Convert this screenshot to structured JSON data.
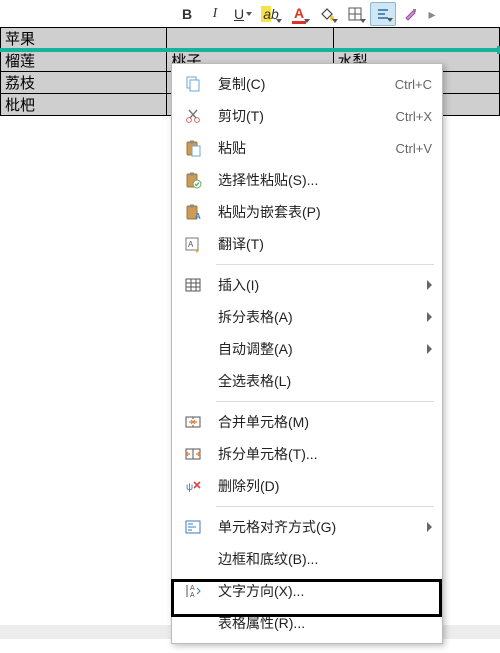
{
  "table": {
    "rows": [
      [
        "苹果",
        "",
        ""
      ],
      [
        "榴莲",
        "桃子",
        "水梨"
      ],
      [
        "荔枝",
        "",
        ""
      ],
      [
        "枇杷",
        "",
        ""
      ]
    ],
    "selected_row_index": 1
  },
  "toolbar": {
    "bold_glyph": "B",
    "italic_glyph": "I",
    "underline_glyph": "U",
    "highlight_glyph": "ab",
    "fontcolor_glyph": "A"
  },
  "colors": {
    "selection": "#17b29c",
    "cell_bg": "#cfcfcf"
  },
  "context_menu": {
    "items": [
      {
        "icon": "copy-icon",
        "label": "复制(C)",
        "shortcut": "Ctrl+C"
      },
      {
        "icon": "cut-icon",
        "label": "剪切(T)",
        "shortcut": "Ctrl+X"
      },
      {
        "icon": "paste-icon",
        "label": "粘贴",
        "shortcut": "Ctrl+V"
      },
      {
        "icon": "paste-special-icon",
        "label": "选择性粘贴(S)...",
        "shortcut": ""
      },
      {
        "icon": "paste-nested-icon",
        "label": "粘贴为嵌套表(P)",
        "shortcut": ""
      },
      {
        "icon": "translate-icon",
        "label": "翻译(T)",
        "shortcut": ""
      },
      {
        "sep": true
      },
      {
        "icon": "table-icon",
        "label": "插入(I)",
        "submenu": true
      },
      {
        "icon": "",
        "label": "拆分表格(A)",
        "submenu": true
      },
      {
        "icon": "",
        "label": "自动调整(A)",
        "submenu": true
      },
      {
        "icon": "",
        "label": "全选表格(L)",
        "shortcut": ""
      },
      {
        "sep": true
      },
      {
        "icon": "merge-cells-icon",
        "label": "合并单元格(M)",
        "shortcut": ""
      },
      {
        "icon": "split-cells-icon",
        "label": "拆分单元格(T)...",
        "shortcut": ""
      },
      {
        "icon": "delete-col-icon",
        "label": "删除列(D)",
        "shortcut": ""
      },
      {
        "sep": true
      },
      {
        "icon": "cell-align-icon",
        "label": "单元格对齐方式(G)",
        "submenu": true,
        "highlighted": true
      },
      {
        "icon": "",
        "label": "边框和底纹(B)...",
        "shortcut": ""
      },
      {
        "icon": "text-dir-icon",
        "label": "文字方向(X)...",
        "shortcut": ""
      },
      {
        "icon": "",
        "label": "表格属性(R)...",
        "shortcut": ""
      }
    ]
  }
}
